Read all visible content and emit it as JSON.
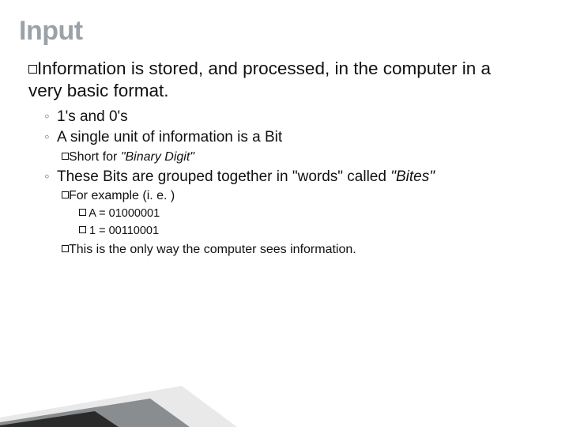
{
  "title": "Input",
  "main": {
    "lead": "Information",
    "rest": " is stored, and processed, in the computer in a very basic format."
  },
  "sub": {
    "a": "1's and 0's",
    "b": "A single unit of information is a Bit",
    "b_sub_pre": "Short for ",
    "b_sub_it": "\"Binary Digit\"",
    "c_pre": "These Bits are grouped together in \"words\" called ",
    "c_it": "\"Bites\"",
    "c_sub1": "For example (i. e. )",
    "c_sub1_a": "A = 01000001",
    "c_sub1_b": "1 = 00110001",
    "c_sub2": "This is the only way the computer sees information."
  }
}
